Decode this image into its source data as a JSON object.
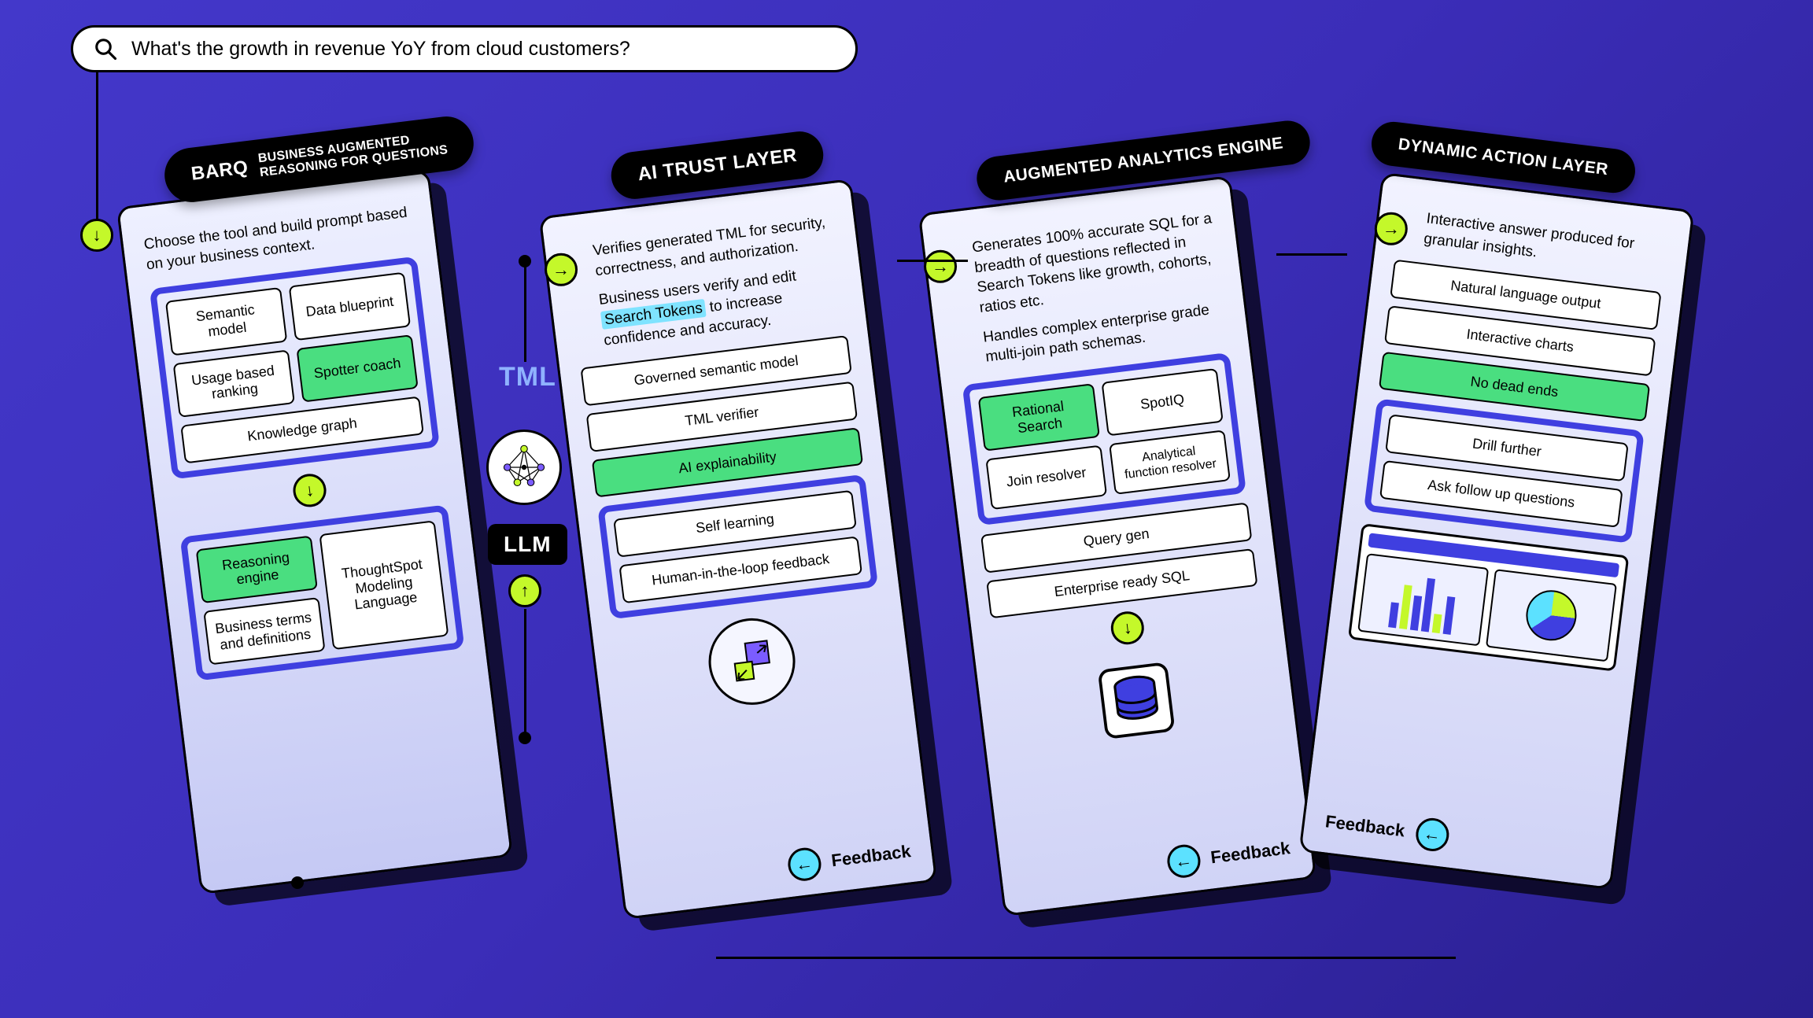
{
  "search": {
    "placeholder": "What's the growth in revenue YoY from cloud customers?",
    "value": "What's the growth in revenue YoY from cloud customers?"
  },
  "columns": {
    "barq": {
      "header_big": "BARQ",
      "header_sub": "BUSINESS AUGMENTED\nREASONING FOR QUESTIONS",
      "desc": "Choose the tool and build prompt based on your business context.",
      "chips_top": [
        {
          "label": "Semantic model",
          "green": false
        },
        {
          "label": "Data blueprint",
          "green": false
        },
        {
          "label": "Usage based ranking",
          "green": false
        },
        {
          "label": "Spotter coach",
          "green": true
        },
        {
          "label": "Knowledge graph",
          "green": false,
          "full": true
        }
      ],
      "chips_bottom_left": [
        {
          "label": "Reasoning engine",
          "green": true
        },
        {
          "label": "Business terms and definitions",
          "green": false
        }
      ],
      "chips_bottom_right": {
        "label": "ThoughtSpot Modeling Language"
      }
    },
    "trust": {
      "header": "AI TRUST LAYER",
      "desc1": "Verifies generated TML for security, correctness, and authorization.",
      "desc2_a": "Business users verify and edit ",
      "desc2_hl": "Search Tokens",
      "desc2_b": " to increase confidence and accuracy.",
      "chips_plain": [
        {
          "label": "Governed semantic model"
        },
        {
          "label": "TML verifier"
        },
        {
          "label": "AI explainability",
          "green": true
        }
      ],
      "chips_framed": [
        {
          "label": "Self learning"
        },
        {
          "label": "Human-in-the-loop feedback"
        }
      ],
      "feedback": "Feedback"
    },
    "analytics": {
      "header": "AUGMENTED ANALYTICS ENGINE",
      "desc1": "Generates 100% accurate SQL for a breadth of questions reflected in Search Tokens like growth, cohorts, ratios etc.",
      "desc2": "Handles complex enterprise grade multi-join path schemas.",
      "chips_framed": [
        {
          "label": "Rational Search",
          "green": true
        },
        {
          "label": "SpotIQ"
        },
        {
          "label": "Join resolver"
        },
        {
          "label": "Analytical function resolver"
        }
      ],
      "chips_plain": [
        {
          "label": "Query gen"
        },
        {
          "label": "Enterprise ready SQL"
        }
      ],
      "feedback": "Feedback"
    },
    "action": {
      "header": "DYNAMIC ACTION LAYER",
      "desc": "Interactive answer produced for granular insights.",
      "chips_plain": [
        {
          "label": "Natural language output"
        },
        {
          "label": "Interactive charts"
        },
        {
          "label": "No dead ends",
          "green": true
        }
      ],
      "chips_framed": [
        {
          "label": "Drill further"
        },
        {
          "label": "Ask follow up questions"
        }
      ],
      "feedback": "Feedback"
    }
  },
  "middle": {
    "tml": "TML",
    "llm": "LLM"
  }
}
